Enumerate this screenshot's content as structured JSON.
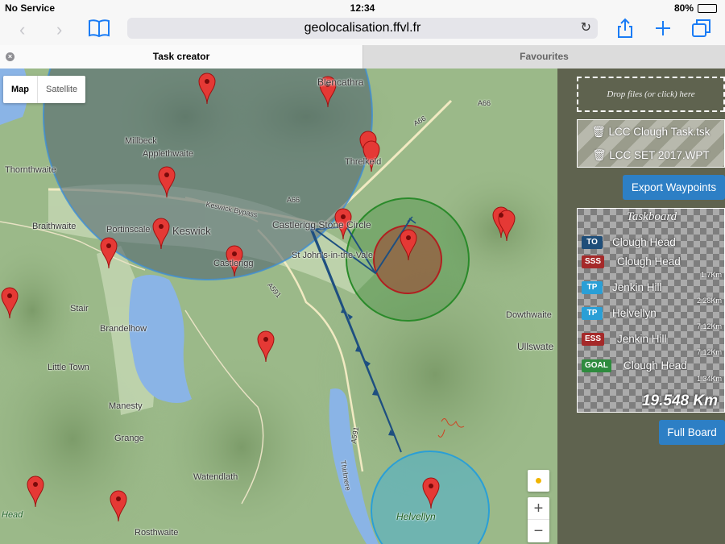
{
  "status": {
    "carrier": "No Service",
    "time": "12:34",
    "battery": "80%",
    "battery_level": 0.8
  },
  "browser": {
    "url": "geolocalisation.ffvl.fr"
  },
  "tabs": [
    {
      "label": "Task creator",
      "active": true
    },
    {
      "label": "Favourites",
      "active": false
    }
  ],
  "map": {
    "type_control": {
      "map": "Map",
      "satellite": "Satellite"
    },
    "zoom_in": "+",
    "zoom_out": "−",
    "places": [
      "Millbeck",
      "Applethwaite",
      "Thornthwaite",
      "Braithwaite",
      "Portinscale",
      "Keswick",
      "Castlerigg Stone Circle",
      "St John's-in-the-Vale",
      "Threlkeld",
      "Blencathra",
      "Stair",
      "Brandelhow",
      "Little Town",
      "Manesty",
      "Grange",
      "Watendlath",
      "Rosthwaite",
      "Head",
      "Helvellyn",
      "Dowthwaite",
      "Ullswate",
      "Castlerigg",
      "Thirlmere",
      "A66",
      "A591",
      "Keswick Bypass"
    ]
  },
  "panel": {
    "drop_text": "Drop files (or click) here",
    "files": [
      "🗑 LCC Clough Task.tsk",
      "🗑 LCC SET 2017.WPT"
    ],
    "export_button": "Export Waypoints",
    "taskboard_title": "Taskboard",
    "turnpoints": [
      {
        "badge": "TO",
        "color": "#1f4e79",
        "name": "Clough Head",
        "leg": ""
      },
      {
        "badge": "SSS",
        "color": "#a52a2a",
        "name": "Clough Head",
        "leg": "1.7Km"
      },
      {
        "badge": "TP",
        "color": "#2a9fd6",
        "name": "Jenkin Hill",
        "leg": "2.28Km"
      },
      {
        "badge": "TP",
        "color": "#2a9fd6",
        "name": "Helvellyn",
        "leg": "7.12Km"
      },
      {
        "badge": "ESS",
        "color": "#a52a2a",
        "name": "Jenkin Hill",
        "leg": "7.12Km"
      },
      {
        "badge": "GOAL",
        "color": "#2e8b3e",
        "name": "Clough Head",
        "leg": "1.34Km"
      }
    ],
    "total_distance": "19.548 Km",
    "full_board_button": "Full Board"
  }
}
